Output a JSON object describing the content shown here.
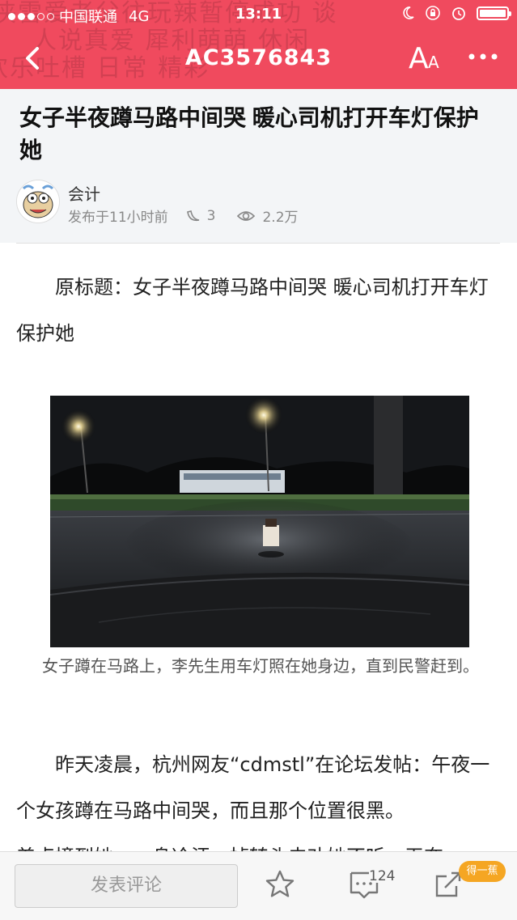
{
  "status_bar": {
    "carrier": "中国联通",
    "network": "4G",
    "time": "13:11"
  },
  "header": {
    "title": "AC3576843",
    "back_icon": "chevron-left-icon",
    "font_icon": "font-size-icon",
    "more_icon": "more-dots-icon",
    "background_color": "#f04a5e"
  },
  "article": {
    "headline": "女子半夜蹲马路中间哭 暖心司机打开车灯保护她",
    "author": "会计",
    "published": "发布于11小时前",
    "bananas": "3",
    "views": "2.2万",
    "intro": "原标题：女子半夜蹲马路中间哭 暖心司机打开车灯保护她",
    "image_caption": "女子蹲在马路上，李先生用车灯照在她身边，直到民警赶到。",
    "body_line1": "昨天凌晨，杭州网友“cdmstl”在论坛发帖：午夜一个女孩蹲在马路中间哭，而且那个位置很黑。",
    "body_line2": "差点撞到她，一身冷汗，掉转头去劝她不听，无奈"
  },
  "bottom_bar": {
    "comment_placeholder": "发表评论",
    "favorite_icon": "star-icon",
    "comments_icon": "comment-icon",
    "comment_count": "124",
    "share_icon": "share-icon",
    "banana_badge": "得一蕉",
    "badge_color": "#f5a623"
  }
}
